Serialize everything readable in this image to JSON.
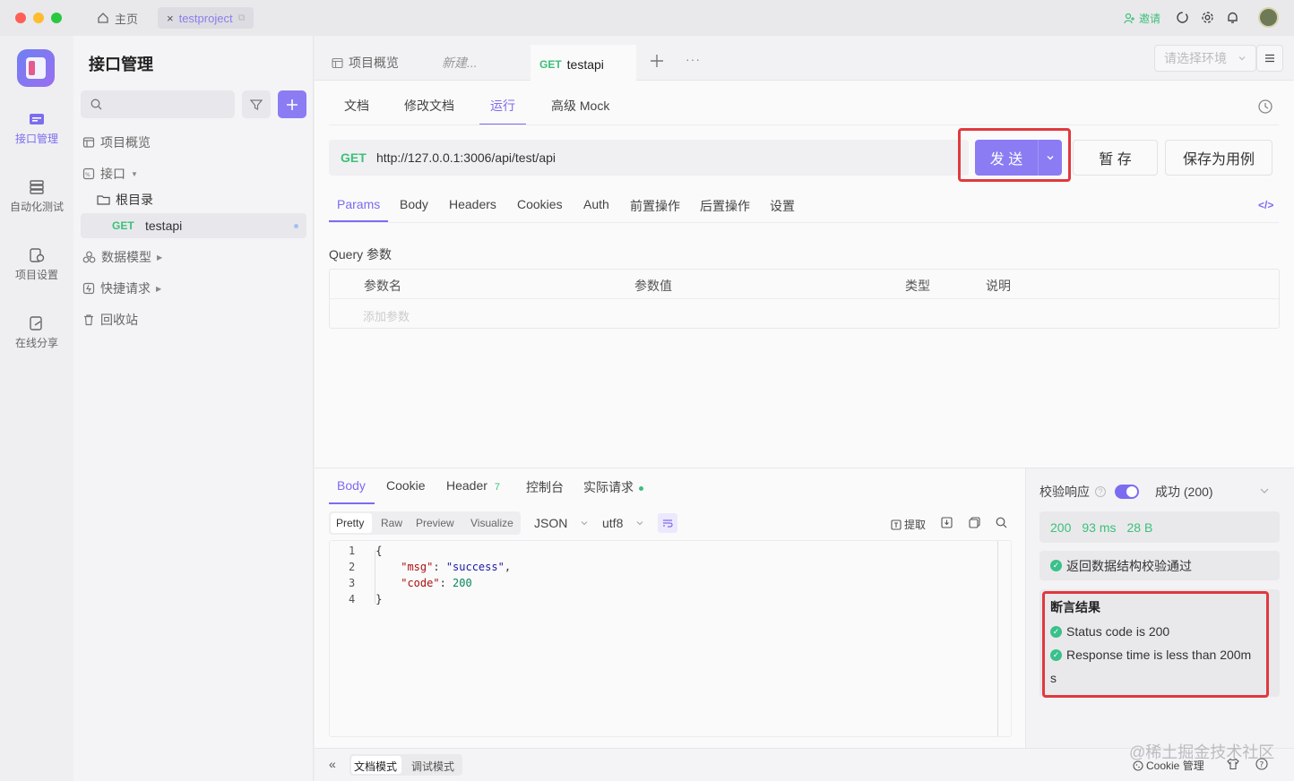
{
  "titlebar": {
    "home_label": "主页",
    "project_tab": "testproject",
    "invite_label": "邀请"
  },
  "rail": {
    "items": [
      {
        "label": "接口管理"
      },
      {
        "label": "自动化测试"
      },
      {
        "label": "项目设置"
      },
      {
        "label": "在线分享"
      }
    ]
  },
  "sidebar": {
    "title": "接口管理",
    "search_placeholder": "",
    "overview": "项目概览",
    "api": "接口",
    "root": "根目录",
    "api_item_method": "GET",
    "api_item_name": "testapi",
    "data_model": "数据模型",
    "quick_request": "快捷请求",
    "recycle": "回收站"
  },
  "doc_tabs": {
    "overview": "项目概览",
    "new": "新建...",
    "active_method": "GET",
    "active_name": "testapi",
    "env_placeholder": "请选择环境"
  },
  "sub_tabs": [
    "文档",
    "修改文档",
    "运行",
    "高级 Mock"
  ],
  "request": {
    "method": "GET",
    "url": "http://127.0.0.1:3006/api/test/api",
    "send": "发 送",
    "save_temp": "暂 存",
    "save_case": "保存为用例"
  },
  "req_tabs": [
    "Params",
    "Body",
    "Headers",
    "Cookies",
    "Auth",
    "前置操作",
    "后置操作",
    "设置"
  ],
  "query": {
    "title": "Query 参数",
    "headers": [
      "参数名",
      "参数值",
      "类型",
      "说明"
    ],
    "add_placeholder": "添加参数"
  },
  "response": {
    "tabs": {
      "body": "Body",
      "cookie": "Cookie",
      "header": "Header",
      "header_count": "7",
      "console": "控制台",
      "actual": "实际请求"
    },
    "formats": [
      "Pretty",
      "Raw",
      "Preview",
      "Visualize"
    ],
    "lang": "JSON",
    "encoding": "utf8",
    "extract": "提取",
    "lines": [
      {
        "n": "1",
        "text": "{"
      },
      {
        "n": "2",
        "key": "\"msg\"",
        "val": "\"success\"",
        "tail": ","
      },
      {
        "n": "3",
        "key": "\"code\"",
        "val": "200",
        "tail": ""
      },
      {
        "n": "4",
        "text": "}"
      }
    ]
  },
  "validate": {
    "label": "校验响应",
    "status": "成功 (200)",
    "code": "200",
    "time": "93 ms",
    "size": "28 B",
    "schema_ok": "返回数据结构校验通过",
    "assert_title": "断言结果",
    "assert_1": "Status code is 200",
    "assert_2": "Response time is less than 200m",
    "assert_2_wrap": "s"
  },
  "bottom": {
    "doc_mode": "文档模式",
    "debug_mode": "调试模式",
    "cookie_manage": "Cookie 管理",
    "watermark": "@稀土掘金技术社区"
  },
  "colors": {
    "accent": "#7b6cf0",
    "get": "#3dbf7a",
    "highlight": "#e0393e",
    "success": "#3ac08b"
  }
}
